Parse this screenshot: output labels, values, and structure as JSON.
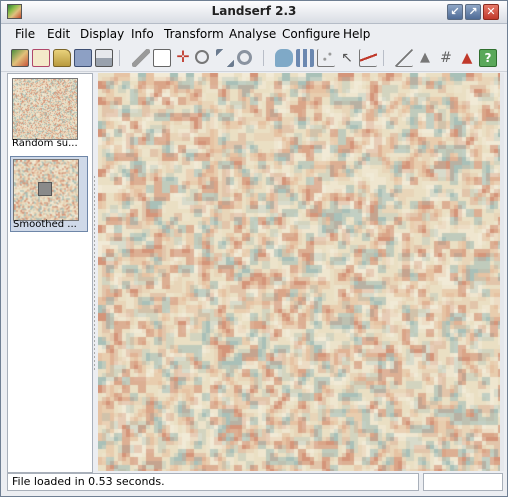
{
  "window": {
    "title": "Landserf 2.3"
  },
  "menubar": {
    "items": [
      {
        "label": "File",
        "icon": ""
      },
      {
        "label": "Edit"
      },
      {
        "label": "Display"
      },
      {
        "label": "Info"
      },
      {
        "label": "Transform"
      },
      {
        "label": "Analyse"
      },
      {
        "label": "Configure"
      },
      {
        "label": "Help"
      }
    ]
  },
  "toolbar": {
    "buttons": [
      "new-raster-icon",
      "new-vector-icon",
      "open-folder-icon",
      "save-disk-icon",
      "print-icon",
      "edit-pencil-icon",
      "text-document-icon",
      "transform-axes-icon",
      "zoom-icon",
      "path-icon",
      "refresh-icon",
      "speech-bubble-icon",
      "histogram-icon",
      "scatter-icon",
      "query-cursor-icon",
      "profile-line-icon",
      "slope-angle-icon",
      "feature-icon",
      "grid-icon",
      "terrain-icon",
      "help-icon"
    ]
  },
  "sidebar": {
    "thumbnails": [
      {
        "label": "Random su..."
      },
      {
        "label": "Smoothed ..."
      }
    ]
  },
  "status": {
    "text": "File loaded in 0.53 seconds."
  },
  "colors": {
    "surface_light": "#eadfc4",
    "surface_peach": "#e6c3a4",
    "surface_red": "#d4957a",
    "surface_teal": "#a9c1b8",
    "surface_pale": "#f2ead6"
  }
}
